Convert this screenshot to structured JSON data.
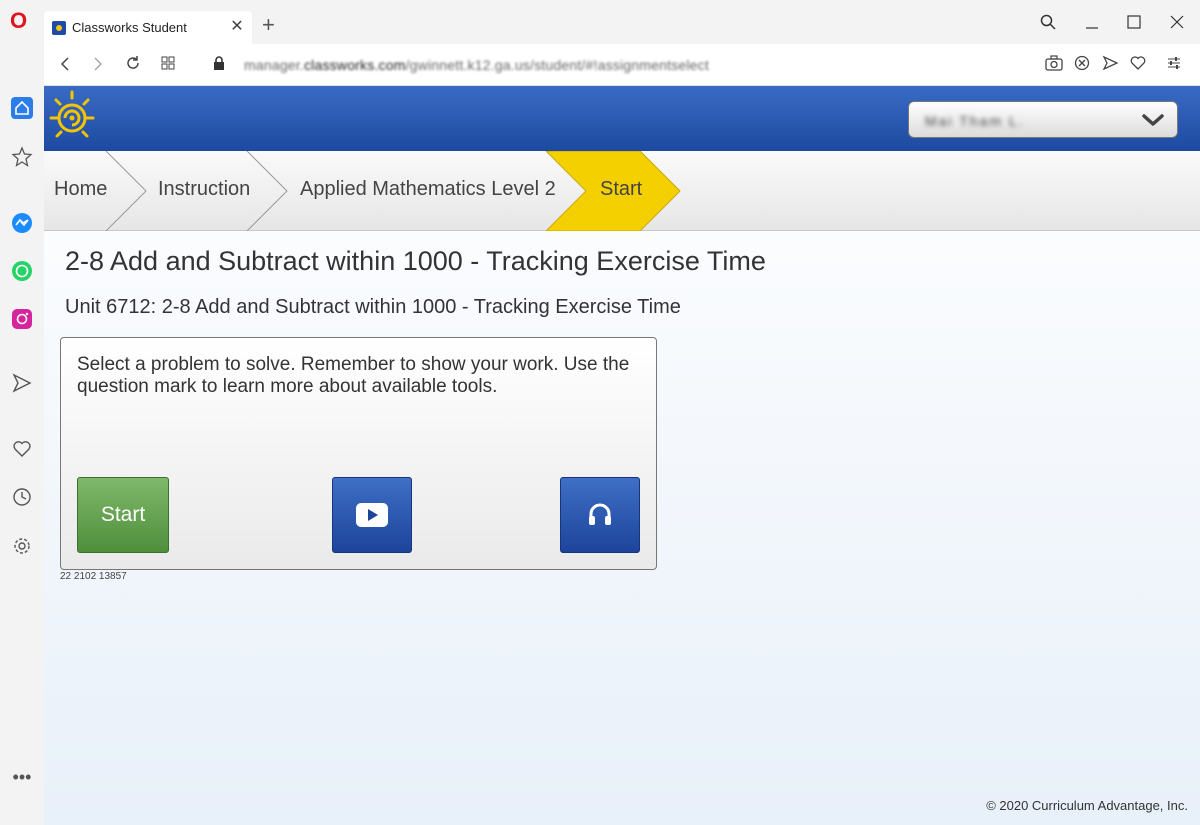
{
  "browser": {
    "tab_title": "Classworks Student",
    "url_prefix": "manager.",
    "url_domain": "classworks.com",
    "url_rest": "/gwinnett.k12.ga.us/student/#!assignmentselect"
  },
  "header": {
    "user_display": "Mai Tham L."
  },
  "breadcrumbs": [
    "Home",
    "Instruction",
    "Applied Mathematics Level 2",
    "Start"
  ],
  "colors": {
    "banner": "#1d4aa0",
    "active_crumb": "#f5d000",
    "start_button": "#5c9b46",
    "media_button": "#2a56b0"
  },
  "main": {
    "title": "2-8 Add and Subtract within 1000 - Tracking Exercise Time",
    "unit_title": "Unit 6712: 2-8 Add and Subtract within 1000 - Tracking Exercise Time",
    "instructions": "Select a problem to solve. Remember to show your work. Use the question mark to learn more about available tools.",
    "start_label": "Start",
    "video_icon": "play-video-icon",
    "audio_icon": "headphones-icon",
    "code": "22 2102 13857"
  },
  "footer": {
    "copyright": "© 2020 Curriculum Advantage, Inc."
  }
}
